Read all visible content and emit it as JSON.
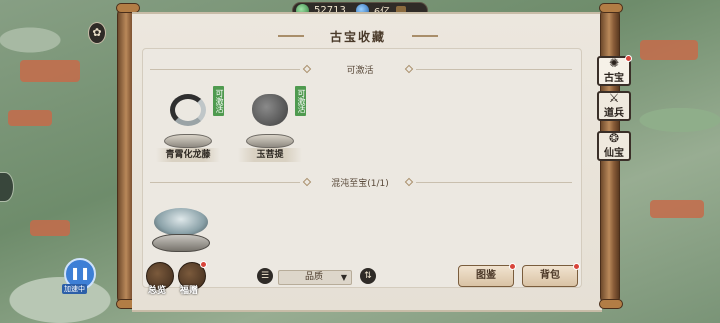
{
  "resources": {
    "jade_amount": "52713",
    "spirit_amount": "6亿"
  },
  "window": {
    "title": "古宝收藏"
  },
  "sections": {
    "activatable": "可激活",
    "chaos": "混沌至宝(1/1)"
  },
  "items": [
    {
      "name": "青霄化龙藤",
      "tag": "可激活"
    },
    {
      "name": "玉菩提",
      "tag": "可激活"
    }
  ],
  "side_tabs": [
    {
      "label": "古宝",
      "icon": "ancient-treasure-icon"
    },
    {
      "label": "道兵",
      "icon": "dao-weapon-icon"
    },
    {
      "label": "仙宝",
      "icon": "immortal-treasure-icon"
    }
  ],
  "controls": {
    "quality_select": "品质",
    "gallery_button": "图鉴",
    "bag_button": "背包",
    "overview_label": "总览",
    "welfare_label": "福赠",
    "speed_label": "加速中"
  }
}
